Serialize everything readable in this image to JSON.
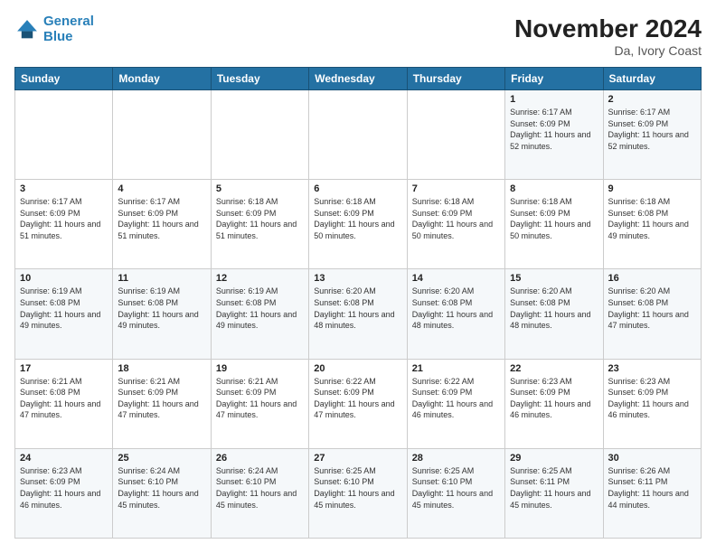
{
  "logo": {
    "line1": "General",
    "line2": "Blue"
  },
  "header": {
    "month": "November 2024",
    "location": "Da, Ivory Coast"
  },
  "days_of_week": [
    "Sunday",
    "Monday",
    "Tuesday",
    "Wednesday",
    "Thursday",
    "Friday",
    "Saturday"
  ],
  "weeks": [
    [
      {
        "num": "",
        "detail": ""
      },
      {
        "num": "",
        "detail": ""
      },
      {
        "num": "",
        "detail": ""
      },
      {
        "num": "",
        "detail": ""
      },
      {
        "num": "",
        "detail": ""
      },
      {
        "num": "1",
        "detail": "Sunrise: 6:17 AM\nSunset: 6:09 PM\nDaylight: 11 hours and 52 minutes."
      },
      {
        "num": "2",
        "detail": "Sunrise: 6:17 AM\nSunset: 6:09 PM\nDaylight: 11 hours and 52 minutes."
      }
    ],
    [
      {
        "num": "3",
        "detail": "Sunrise: 6:17 AM\nSunset: 6:09 PM\nDaylight: 11 hours and 51 minutes."
      },
      {
        "num": "4",
        "detail": "Sunrise: 6:17 AM\nSunset: 6:09 PM\nDaylight: 11 hours and 51 minutes."
      },
      {
        "num": "5",
        "detail": "Sunrise: 6:18 AM\nSunset: 6:09 PM\nDaylight: 11 hours and 51 minutes."
      },
      {
        "num": "6",
        "detail": "Sunrise: 6:18 AM\nSunset: 6:09 PM\nDaylight: 11 hours and 50 minutes."
      },
      {
        "num": "7",
        "detail": "Sunrise: 6:18 AM\nSunset: 6:09 PM\nDaylight: 11 hours and 50 minutes."
      },
      {
        "num": "8",
        "detail": "Sunrise: 6:18 AM\nSunset: 6:09 PM\nDaylight: 11 hours and 50 minutes."
      },
      {
        "num": "9",
        "detail": "Sunrise: 6:18 AM\nSunset: 6:08 PM\nDaylight: 11 hours and 49 minutes."
      }
    ],
    [
      {
        "num": "10",
        "detail": "Sunrise: 6:19 AM\nSunset: 6:08 PM\nDaylight: 11 hours and 49 minutes."
      },
      {
        "num": "11",
        "detail": "Sunrise: 6:19 AM\nSunset: 6:08 PM\nDaylight: 11 hours and 49 minutes."
      },
      {
        "num": "12",
        "detail": "Sunrise: 6:19 AM\nSunset: 6:08 PM\nDaylight: 11 hours and 49 minutes."
      },
      {
        "num": "13",
        "detail": "Sunrise: 6:20 AM\nSunset: 6:08 PM\nDaylight: 11 hours and 48 minutes."
      },
      {
        "num": "14",
        "detail": "Sunrise: 6:20 AM\nSunset: 6:08 PM\nDaylight: 11 hours and 48 minutes."
      },
      {
        "num": "15",
        "detail": "Sunrise: 6:20 AM\nSunset: 6:08 PM\nDaylight: 11 hours and 48 minutes."
      },
      {
        "num": "16",
        "detail": "Sunrise: 6:20 AM\nSunset: 6:08 PM\nDaylight: 11 hours and 47 minutes."
      }
    ],
    [
      {
        "num": "17",
        "detail": "Sunrise: 6:21 AM\nSunset: 6:08 PM\nDaylight: 11 hours and 47 minutes."
      },
      {
        "num": "18",
        "detail": "Sunrise: 6:21 AM\nSunset: 6:09 PM\nDaylight: 11 hours and 47 minutes."
      },
      {
        "num": "19",
        "detail": "Sunrise: 6:21 AM\nSunset: 6:09 PM\nDaylight: 11 hours and 47 minutes."
      },
      {
        "num": "20",
        "detail": "Sunrise: 6:22 AM\nSunset: 6:09 PM\nDaylight: 11 hours and 47 minutes."
      },
      {
        "num": "21",
        "detail": "Sunrise: 6:22 AM\nSunset: 6:09 PM\nDaylight: 11 hours and 46 minutes."
      },
      {
        "num": "22",
        "detail": "Sunrise: 6:23 AM\nSunset: 6:09 PM\nDaylight: 11 hours and 46 minutes."
      },
      {
        "num": "23",
        "detail": "Sunrise: 6:23 AM\nSunset: 6:09 PM\nDaylight: 11 hours and 46 minutes."
      }
    ],
    [
      {
        "num": "24",
        "detail": "Sunrise: 6:23 AM\nSunset: 6:09 PM\nDaylight: 11 hours and 46 minutes."
      },
      {
        "num": "25",
        "detail": "Sunrise: 6:24 AM\nSunset: 6:10 PM\nDaylight: 11 hours and 45 minutes."
      },
      {
        "num": "26",
        "detail": "Sunrise: 6:24 AM\nSunset: 6:10 PM\nDaylight: 11 hours and 45 minutes."
      },
      {
        "num": "27",
        "detail": "Sunrise: 6:25 AM\nSunset: 6:10 PM\nDaylight: 11 hours and 45 minutes."
      },
      {
        "num": "28",
        "detail": "Sunrise: 6:25 AM\nSunset: 6:10 PM\nDaylight: 11 hours and 45 minutes."
      },
      {
        "num": "29",
        "detail": "Sunrise: 6:25 AM\nSunset: 6:11 PM\nDaylight: 11 hours and 45 minutes."
      },
      {
        "num": "30",
        "detail": "Sunrise: 6:26 AM\nSunset: 6:11 PM\nDaylight: 11 hours and 44 minutes."
      }
    ]
  ]
}
